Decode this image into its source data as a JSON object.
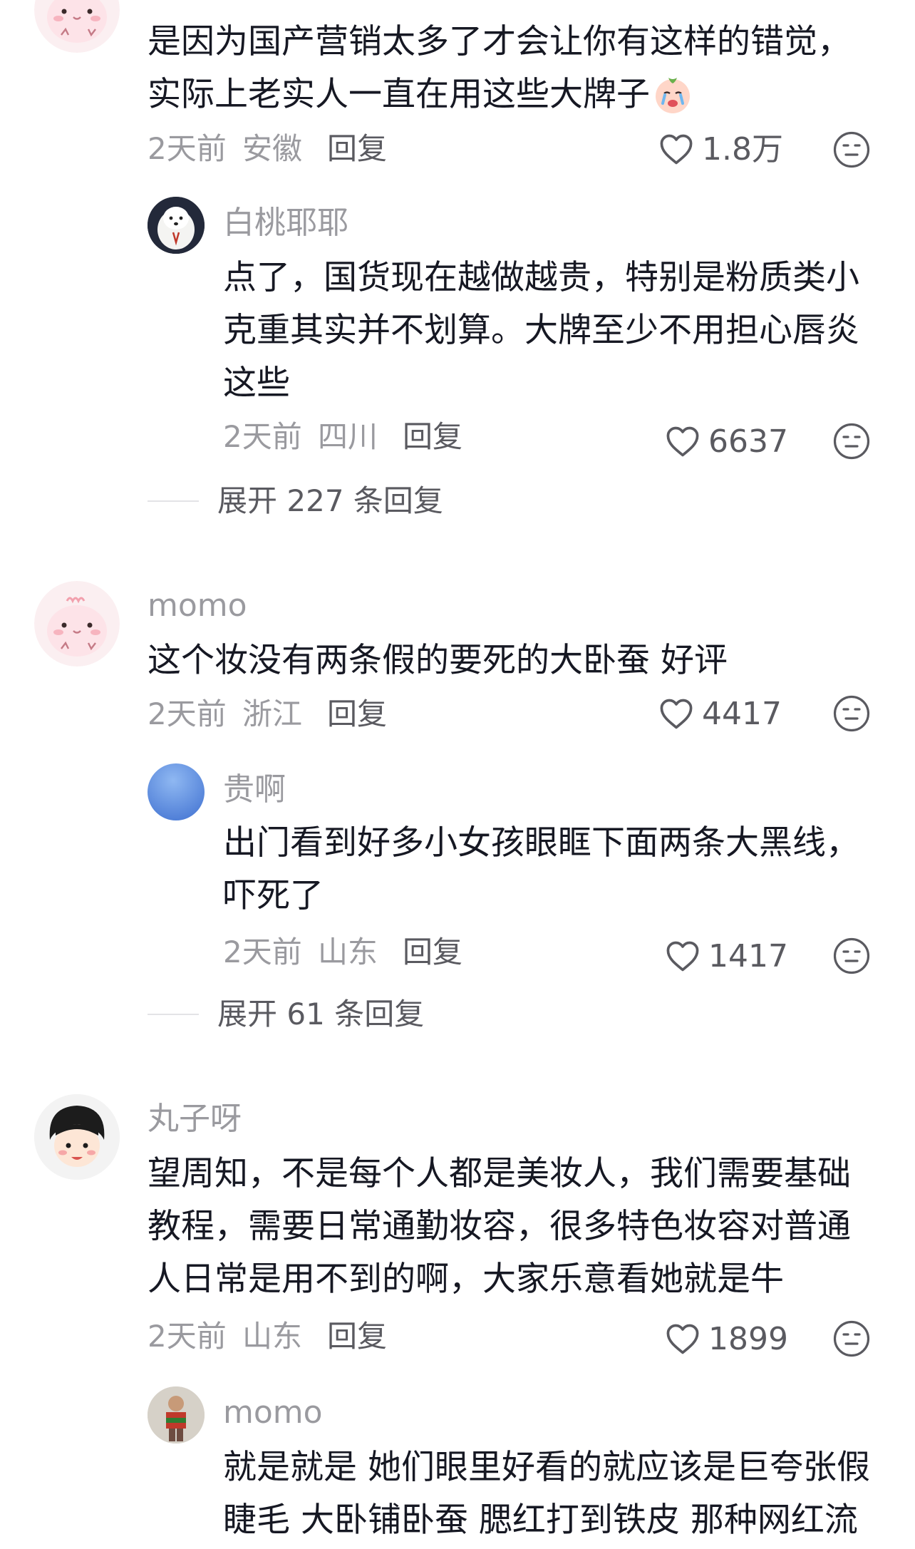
{
  "comments": [
    {
      "text_lines": [
        "是因为国产营销太多了才会让你有这样的错觉，",
        "实际上老实人一直在用这些大牌子"
      ],
      "time": "2天前",
      "location": "安徽",
      "reply_label": "回复",
      "likes": "1.8万",
      "reply": {
        "username": "白桃耶耶",
        "text_lines": [
          "点了，国货现在越做越贵，特别是粉质类小",
          "克重其实并不划算。大牌至少不用担心唇炎",
          "这些"
        ],
        "time": "2天前",
        "location": "四川",
        "reply_label": "回复",
        "likes": "6637"
      },
      "expand": {
        "prefix": "展开",
        "count": "227",
        "suffix": "条回复"
      }
    },
    {
      "username": "momo",
      "text_lines": [
        "这个妆没有两条假的要死的大卧蚕 好评"
      ],
      "time": "2天前",
      "location": "浙江",
      "reply_label": "回复",
      "likes": "4417",
      "reply": {
        "username": "贵啊",
        "text_lines": [
          "出门看到好多小女孩眼眶下面两条大黑线，",
          "吓死了"
        ],
        "time": "2天前",
        "location": "山东",
        "reply_label": "回复",
        "likes": "1417"
      },
      "expand": {
        "prefix": "展开",
        "count": "61",
        "suffix": "条回复"
      }
    },
    {
      "username": "丸子呀",
      "text_lines": [
        "望周知，不是每个人都是美妆人，我们需要基础",
        "教程，需要日常通勤妆容，很多特色妆容对普通",
        "人日常是用不到的啊，大家乐意看她就是牛"
      ],
      "time": "2天前",
      "location": "山东",
      "reply_label": "回复",
      "likes": "1899",
      "reply": {
        "username": "momo",
        "text_lines": [
          "就是就是 她们眼里好看的就应该是巨夸张假",
          "睫毛 大卧铺卧蚕 腮红打到铁皮 那种网红流"
        ]
      }
    }
  ],
  "icons": {
    "like": "heart-outline-icon",
    "dislike": "neutral-face-icon",
    "emoji": "crying-face-emoji"
  },
  "colors": {
    "text": "#161823",
    "muted": "#9a9a9f",
    "action": "#5a5a60"
  }
}
